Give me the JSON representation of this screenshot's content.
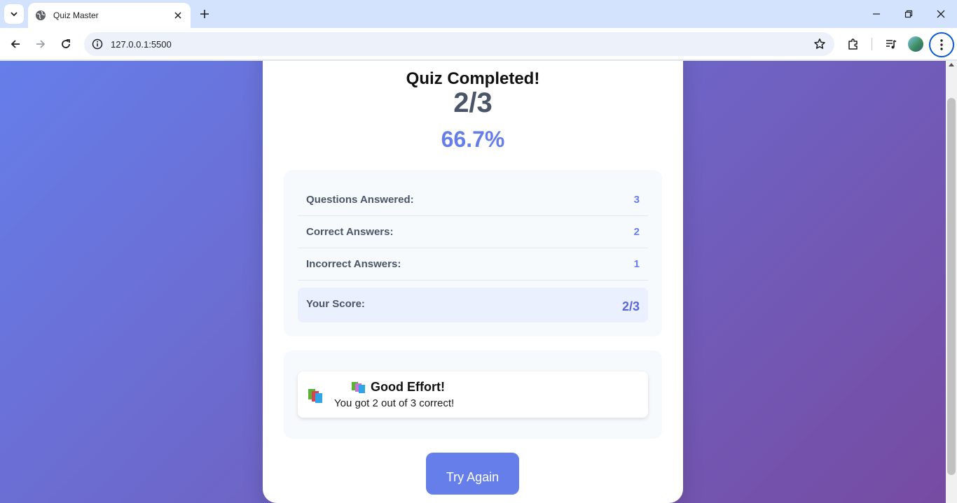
{
  "browser": {
    "tab_title": "Quiz Master",
    "url": "127.0.0.1:5500"
  },
  "quiz": {
    "title": "Quiz Completed!",
    "score_fraction": "2/3",
    "score_percent": "66.7%",
    "stats": [
      {
        "label": "Questions Answered:",
        "value": "3"
      },
      {
        "label": "Correct Answers:",
        "value": "2"
      },
      {
        "label": "Incorrect Answers:",
        "value": "1"
      }
    ],
    "total": {
      "label": "Your Score:",
      "value": "2/3"
    },
    "feedback": {
      "icon": "books-icon",
      "heading": "Good Effort!",
      "message": "You got 2 out of 3 correct!"
    },
    "try_again_label": "Try Again"
  },
  "colors": {
    "accent": "#667eea",
    "gradient_start": "#667eea",
    "gradient_end": "#764ba2"
  }
}
